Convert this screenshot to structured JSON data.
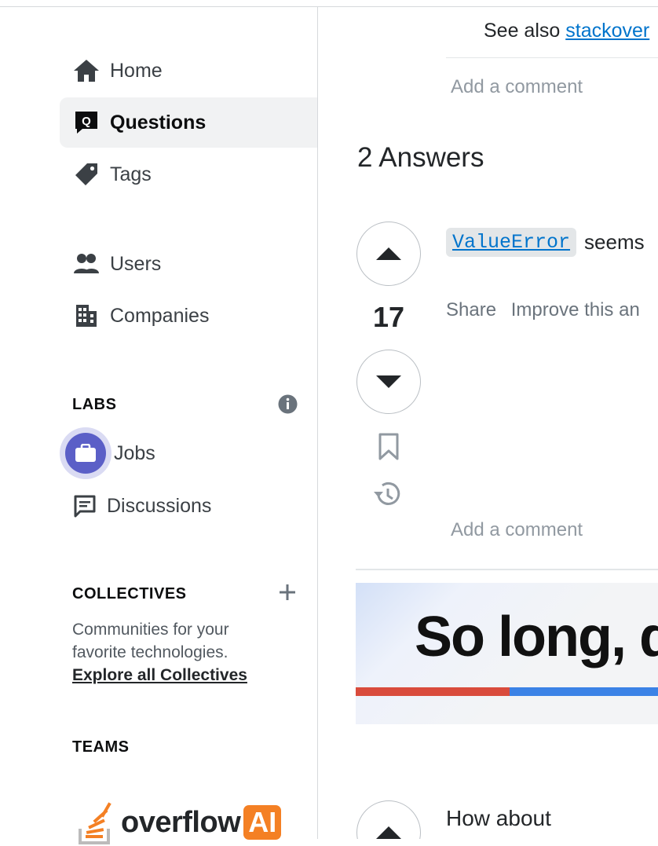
{
  "sidebar": {
    "nav": [
      {
        "label": "Home",
        "icon": "home-icon"
      },
      {
        "label": "Questions",
        "icon": "questions-icon"
      },
      {
        "label": "Tags",
        "icon": "tag-icon"
      },
      {
        "label": "Users",
        "icon": "users-icon"
      },
      {
        "label": "Companies",
        "icon": "companies-icon"
      }
    ],
    "labs": {
      "heading": "LABS",
      "items": [
        {
          "label": "Jobs"
        },
        {
          "label": "Discussions"
        }
      ]
    },
    "collectives": {
      "heading": "COLLECTIVES",
      "description_line1": "Communities for your",
      "description_line2": "favorite technologies.",
      "explore_link": "Explore all Collectives"
    },
    "teams": {
      "heading": "TEAMS"
    },
    "brand_text": "overflow",
    "brand_badge": "AI"
  },
  "main": {
    "see_also_prefix": "See also",
    "see_also_link": "stackover",
    "add_comment_1": "Add a comment",
    "answers_heading": "2 Answers",
    "answer1": {
      "code": "ValueError",
      "text": "seems",
      "vote_count": "17",
      "share": "Share",
      "improve": "Improve this an"
    },
    "add_comment_2": "Add a comment",
    "banner_text": "So long, d",
    "answer2_text": "How about"
  },
  "colors": {
    "accent": "#0074cc",
    "active_bg": "#f1f2f3",
    "labs_purple": "#5b5fc7",
    "banner_red": "#d94b3c",
    "banner_blue": "#3b82e6"
  }
}
